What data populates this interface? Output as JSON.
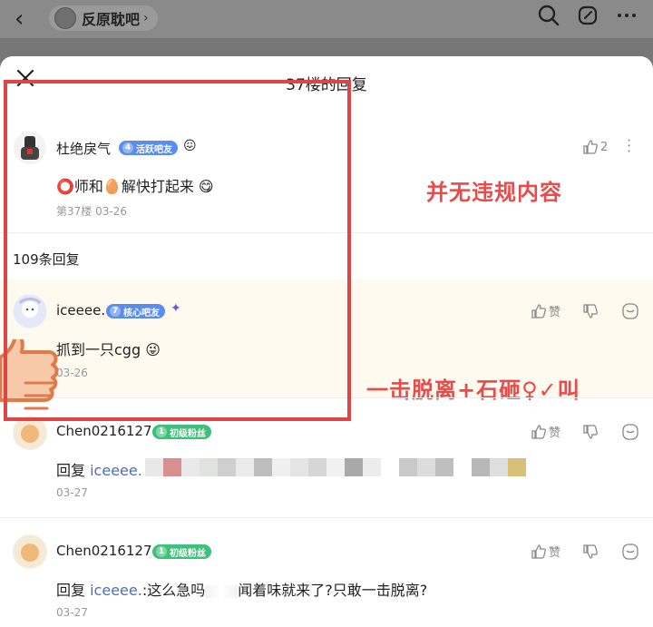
{
  "header": {
    "forum_name": "反原耽吧"
  },
  "sheet": {
    "title": "37楼的回复"
  },
  "main_post": {
    "user": "杜绝戾气",
    "level": "4",
    "badge": "活跃吧友",
    "content": "⭕师和🥚解快打起来 😋",
    "meta": "第37楼  03-26",
    "like_count": "2"
  },
  "reply_count": "109条回复",
  "replies": [
    {
      "user": "iceeee.",
      "level": "7",
      "badge": "核心吧友",
      "content": "抓到一只cgg 😜",
      "date": "03-26",
      "like_label": "赞"
    },
    {
      "user": "Chen0216127",
      "level": "1",
      "badge": "初级粉丝",
      "reply_prefix": "回复",
      "reply_to": "iceeee.",
      "content": "",
      "date": "03-27",
      "like_label": "赞"
    },
    {
      "user": "Chen0216127",
      "level": "1",
      "badge": "初级粉丝",
      "reply_prefix": "回复",
      "reply_to": "iceeee.",
      "content_a": ":这么急吗",
      "content_b": "闻着味就来了?只敢一击脱离?",
      "date": "03-27",
      "like_label": "赞"
    }
  ],
  "annotations": {
    "no_violation": "并无违规内容",
    "hit_and_run": "一击脱离+石砸♀✓叫"
  },
  "colors": {
    "annot_red": "#e94b4b",
    "badge_blue": "#5b8def",
    "badge_green": "#3fc07a",
    "link": "#4a6fb5"
  }
}
